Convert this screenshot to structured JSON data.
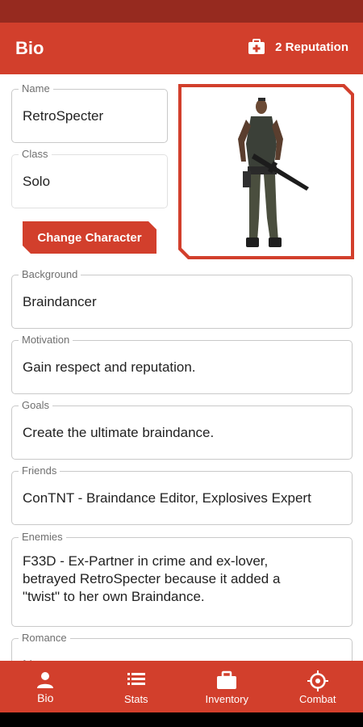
{
  "app_bar": {
    "title": "Bio",
    "reputation": "2 Reputation",
    "reputation_icon": "first-aid-kit-icon"
  },
  "character": {
    "name_label": "Name",
    "name": "RetroSpecter",
    "class_label": "Class",
    "class": "Solo",
    "change_button": "Change Character",
    "portrait": "armed-mercenary-portrait"
  },
  "bio": {
    "background_label": "Background",
    "background": "Braindancer",
    "motivation_label": "Motivation",
    "motivation": "Gain respect and reputation.",
    "goals_label": "Goals",
    "goals": "Create the ultimate braindance.",
    "friends_label": "Friends",
    "friends": "ConTNT - Braindance Editor, Explosives Expert",
    "enemies_label": "Enemies",
    "enemies_line1": "F33D - Ex-Partner in crime and ex-lover,",
    "enemies_line2": "betrayed RetroSpecter because it added a",
    "enemies_line3": "\"twist\" to her own Braindance.",
    "romance_label": "Romance",
    "romance": "N"
  },
  "nav": [
    {
      "label": "Bio",
      "icon": "person-icon",
      "active": true
    },
    {
      "label": "Stats",
      "icon": "list-icon",
      "active": false
    },
    {
      "label": "Inventory",
      "icon": "briefcase-icon",
      "active": false
    },
    {
      "label": "Combat",
      "icon": "crosshair-icon",
      "active": false
    }
  ],
  "colors": {
    "primary": "#d23f2c",
    "status_bar": "#962a1f"
  }
}
